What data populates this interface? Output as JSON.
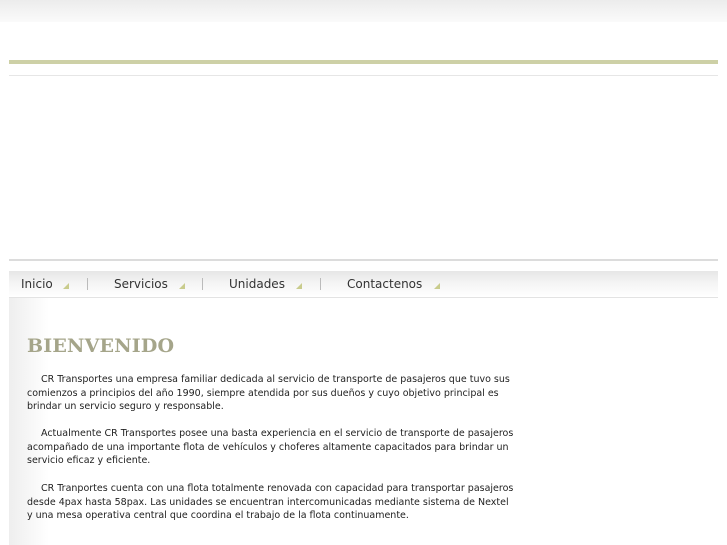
{
  "nav": {
    "items": [
      {
        "label": "Inicio"
      },
      {
        "label": "Servicios"
      },
      {
        "label": "Unidades"
      },
      {
        "label": "Contactenos"
      }
    ]
  },
  "content": {
    "heading": "BIENVENIDO",
    "paragraphs": [
      "CR Transportes una empresa familiar dedicada al servicio de transporte de pasajeros que tuvo sus comienzos a principios del año 1990, siempre atendida por sus dueños y cuyo objetivo principal es brindar un servicio seguro y responsable.",
      "Actualmente CR Transportes posee una basta experiencia en el servicio de transporte de pasajeros acompañado de una importante flota de vehículos y choferes altamente capacitados para brindar un servicio eficaz y eficiente.",
      "CR Tranportes cuenta con una flota totalmente renovada con capacidad para transportar pasajeros desde 4pax hasta 58pax. Las unidades se encuentran intercomunicadas mediante sistema de Nextel y una mesa operativa central que coordina el trabajo de la flota continuamente."
    ]
  },
  "colors": {
    "accent": "#cdd0a6",
    "heading": "#a5a58a",
    "nav_arrow": "#c9cc8d"
  }
}
